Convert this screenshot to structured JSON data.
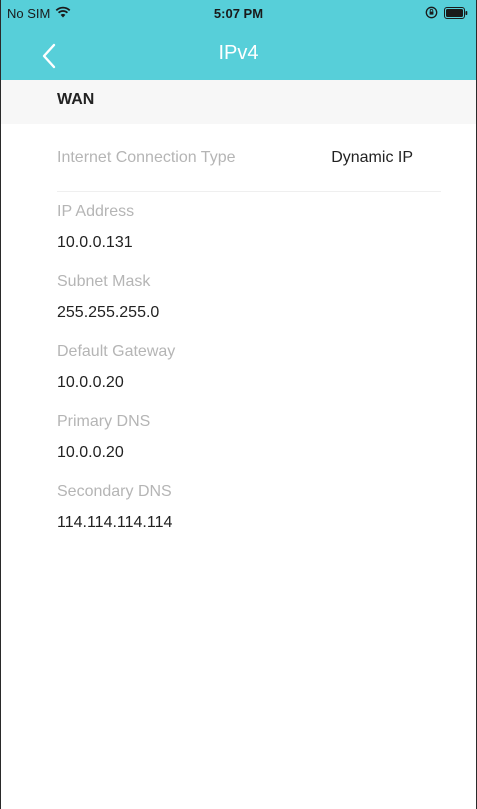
{
  "status_bar": {
    "carrier": "No SIM",
    "time": "5:07 PM"
  },
  "nav": {
    "title": "IPv4"
  },
  "section": {
    "title": "WAN"
  },
  "connection": {
    "label": "Internet Connection Type",
    "value": "Dynamic IP"
  },
  "fields": [
    {
      "label": "IP Address",
      "value": "10.0.0.131"
    },
    {
      "label": "Subnet Mask",
      "value": "255.255.255.0"
    },
    {
      "label": "Default Gateway",
      "value": "10.0.0.20"
    },
    {
      "label": "Primary DNS",
      "value": "10.0.0.20"
    },
    {
      "label": "Secondary DNS",
      "value": "114.114.114.114"
    }
  ],
  "colors": {
    "header": "#57cfd9",
    "section_bg": "#f7f7f7",
    "label": "#b5b5b5",
    "value": "#222222"
  }
}
